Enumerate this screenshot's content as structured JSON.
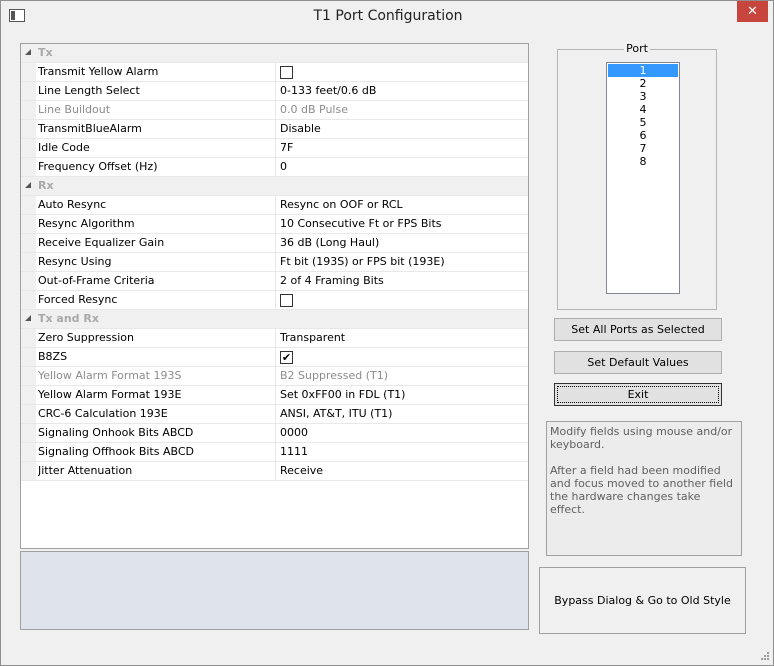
{
  "window": {
    "title": "T1 Port Configuration",
    "close_glyph": "✕"
  },
  "grid": {
    "tx": {
      "title": "Tx",
      "rows": [
        {
          "name": "Transmit Yellow Alarm",
          "type": "checkbox",
          "checked": false
        },
        {
          "name": "Line Length Select",
          "value": "0-133 feet/0.6 dB"
        },
        {
          "name": "Line Buildout",
          "value": "0.0 dB Pulse",
          "disabled": true
        },
        {
          "name": "TransmitBlueAlarm",
          "value": "Disable"
        },
        {
          "name": "Idle Code",
          "value": "7F"
        },
        {
          "name": "Frequency Offset (Hz)",
          "value": "0"
        }
      ]
    },
    "rx": {
      "title": "Rx",
      "rows": [
        {
          "name": "Auto Resync",
          "value": "Resync on OOF or RCL"
        },
        {
          "name": "Resync Algorithm",
          "value": "10 Consecutive Ft or FPS Bits"
        },
        {
          "name": "Receive Equalizer Gain",
          "value": "36 dB (Long Haul)"
        },
        {
          "name": "Resync Using",
          "value": "Ft bit (193S) or FPS bit (193E)"
        },
        {
          "name": "Out-of-Frame Criteria",
          "value": "2 of 4 Framing Bits"
        },
        {
          "name": "Forced Resync",
          "type": "checkbox",
          "checked": false
        }
      ]
    },
    "txrx": {
      "title": "Tx and Rx",
      "rows": [
        {
          "name": "Zero Suppression",
          "value": "Transparent"
        },
        {
          "name": "B8ZS",
          "type": "checkbox",
          "checked": true
        },
        {
          "name": "Yellow Alarm Format 193S",
          "value": "B2 Suppressed (T1)",
          "disabled": true
        },
        {
          "name": "Yellow Alarm Format 193E",
          "value": "Set 0xFF00 in FDL (T1)"
        },
        {
          "name": "CRC-6 Calculation 193E",
          "value": "ANSI, AT&T, ITU (T1)"
        },
        {
          "name": "Signaling Onhook Bits ABCD",
          "value": "0000"
        },
        {
          "name": "Signaling Offhook Bits ABCD",
          "value": "1111"
        },
        {
          "name": "Jitter Attenuation",
          "value": "Receive"
        }
      ]
    }
  },
  "port": {
    "label": "Port",
    "items": [
      "1",
      "2",
      "3",
      "4",
      "5",
      "6",
      "7",
      "8"
    ],
    "selected_index": 0
  },
  "buttons": {
    "set_all": "Set All Ports as Selected",
    "set_default": "Set Default Values",
    "exit": "Exit",
    "bypass": "Bypass  Dialog & Go to Old Style"
  },
  "help": {
    "line1": "Modify fields using mouse and/or keyboard.",
    "line2": "After a field had been modified and focus moved to another field the hardware changes take effect."
  },
  "icons": {
    "category_expander": "triangle-expanded-icon",
    "checkmark": "✔"
  }
}
